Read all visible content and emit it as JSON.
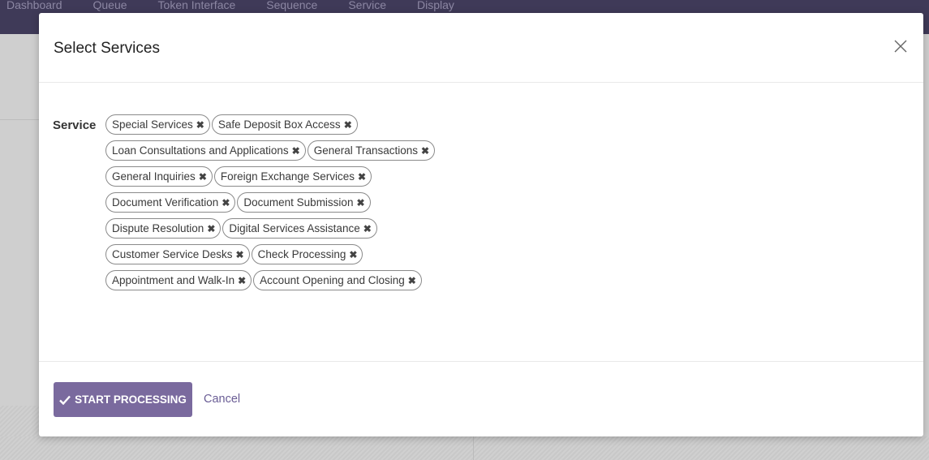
{
  "background_nav": {
    "items": [
      "Dashboard",
      "Queue",
      "Token Interface",
      "Sequence",
      "Service",
      "Display"
    ]
  },
  "modal": {
    "title": "Select Services",
    "close_icon": "close-icon",
    "field_label": "Service",
    "tag_rows": [
      [
        "Special Services",
        "Safe Deposit Box Access"
      ],
      [
        "Loan Consultations and Applications",
        "General Transactions"
      ],
      [
        "General Inquiries",
        "Foreign Exchange Services"
      ],
      [
        "Document Verification",
        "Document Submission"
      ],
      [
        "Dispute Resolution",
        "Digital Services Assistance"
      ],
      [
        "Customer Service Desks",
        "Check Processing"
      ],
      [
        "Appointment and Walk-In",
        "Account Opening and Closing"
      ]
    ],
    "remove_glyph": "✖",
    "primary_button": {
      "icon": "checkmark-icon",
      "label": "START PROCESSING"
    },
    "cancel_label": "Cancel"
  },
  "colors": {
    "nav_bg": "#3f3a58",
    "primary": "#7a6a9e",
    "link": "#6a5d95"
  }
}
